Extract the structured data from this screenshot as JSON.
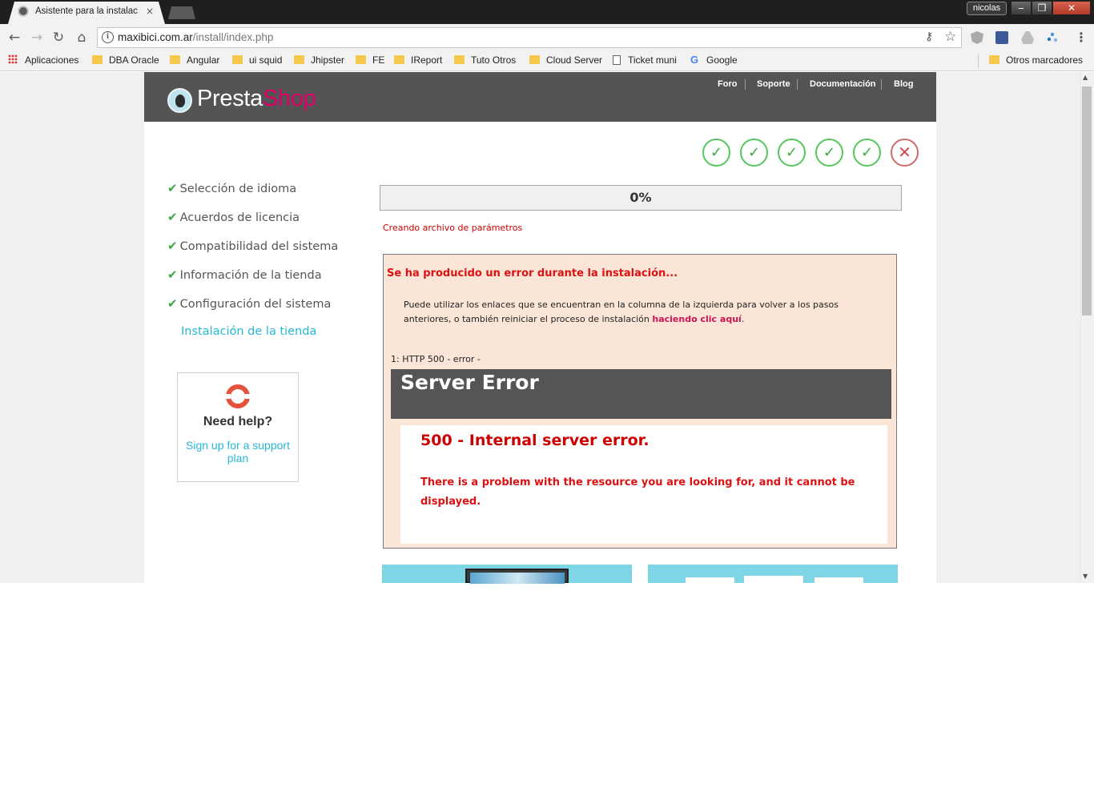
{
  "browser": {
    "tab_title": "Asistente para la instalac",
    "tab_close": "×",
    "user_name": "nicolas",
    "window_min": "‒",
    "window_max": "❐",
    "window_close": "✕",
    "url_host": "maxibici.com.ar",
    "url_path": "/install/index.php",
    "bookmarks": [
      "Aplicaciones",
      "DBA Oracle",
      "Angular",
      "ui squid",
      "Jhipster",
      "FE",
      "IReport",
      "Tuto Otros",
      "Cloud Server",
      "Ticket muni",
      "Google"
    ],
    "other_bookmarks": "Otros marcadores"
  },
  "header": {
    "logo_text_1": "Presta",
    "logo_text_2": "Shop",
    "nav": [
      "Foro",
      "Soporte",
      "Documentación",
      "Blog"
    ]
  },
  "steps_indicator": {
    "completed_glyph": "✓",
    "error_glyph": "✕",
    "states": [
      "done",
      "done",
      "done",
      "done",
      "done",
      "error"
    ]
  },
  "sidebar": {
    "steps": [
      "Selección de idioma",
      "Acuerdos de licencia",
      "Compatibilidad del sistema",
      "Información de la tienda",
      "Configuración del sistema",
      "Instalación de la tienda"
    ],
    "check_glyph": "✔",
    "help_title": "Need help?",
    "help_link": "Sign up for a support plan"
  },
  "progress": {
    "percent_label": "0%",
    "percent": 0,
    "status": "Creando archivo de parámetros"
  },
  "error": {
    "title": "Se ha producido un error durante la instalación...",
    "description": "Puede utilizar los enlaces que se encuentran en la columna de la izquierda para volver a los pasos anteriores, o también reiniciar el proceso de instalación",
    "link_text": "haciendo clic aquí",
    "link_suffix": ".",
    "code_line": "1: HTTP 500 - error -",
    "server_error_title": "Server Error",
    "server_error_code": "500 - Internal server error.",
    "server_error_message": "There is a problem with the resource you are looking for, and it cannot be displayed."
  },
  "colors": {
    "brand_pink": "#df0067",
    "accent_blue": "#25b9d7",
    "success_green": "#55c65c",
    "error_red": "#cc0000"
  }
}
